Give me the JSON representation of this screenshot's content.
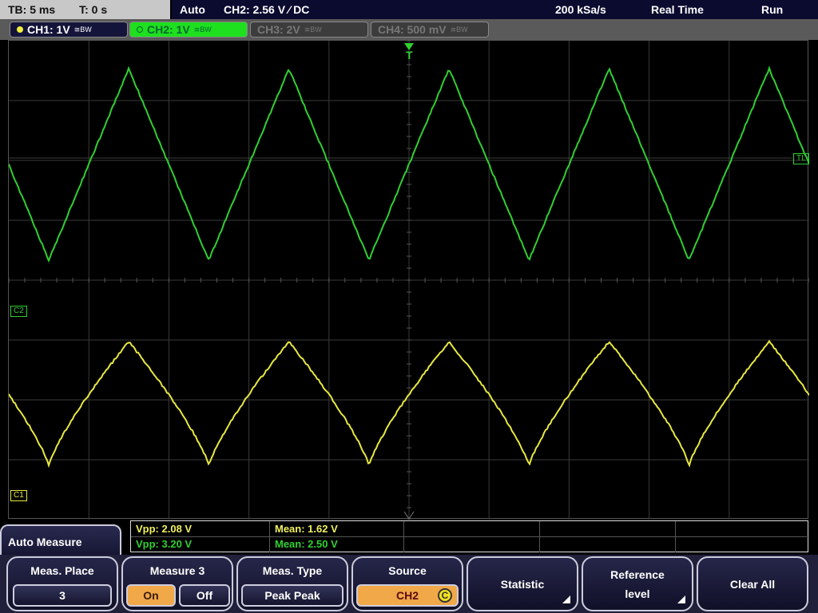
{
  "header": {
    "timebase": "TB: 5 ms",
    "trigger_time": "T: 0 s",
    "mode": "Auto",
    "trigger": "CH2: 2.56 V ⁄ DC",
    "sample_rate": "200 kSa/s",
    "acquisition": "Real Time",
    "run_state": "Run"
  },
  "channels": [
    {
      "label": "CH1: 1V",
      "coupling": "≅BW",
      "state": "active",
      "color": "#f0f040"
    },
    {
      "label": "CH2: 1V",
      "coupling": "≅BW",
      "state": "selected",
      "color": "#20e020"
    },
    {
      "label": "CH3: 2V",
      "coupling": "≅BW",
      "state": "off",
      "color": "#888888"
    },
    {
      "label": "CH4: 500 mV",
      "coupling": "≅BW",
      "state": "off",
      "color": "#888888"
    }
  ],
  "markers": {
    "trigger": "T",
    "trigger_level": "TL",
    "ch2": "C2",
    "ch1": "C1"
  },
  "waveforms": {
    "ch2": {
      "shape": "triangle",
      "period_ms": 10,
      "vpp": 3.2,
      "mean": 2.5,
      "color": "#30d030"
    },
    "ch1": {
      "shape": "triangle",
      "period_ms": 10,
      "vpp": 2.08,
      "mean": 1.62,
      "color": "#e8e840"
    }
  },
  "measurements": {
    "rows": [
      [
        "Vpp: 2.08 V",
        "Mean: 1.62 V",
        "",
        "",
        ""
      ],
      [
        "Vpp: 3.20 V",
        "Mean: 2.50 V",
        "",
        "",
        ""
      ]
    ],
    "row_colors": [
      "#f0f060",
      "#30d030"
    ]
  },
  "menu": {
    "title": "Auto Measure",
    "meas_place": {
      "label": "Meas. Place",
      "value": "3"
    },
    "measure3": {
      "label": "Measure 3",
      "on": "On",
      "off": "Off",
      "selected": "On"
    },
    "meas_type": {
      "label": "Meas. Type",
      "value": "Peak Peak"
    },
    "source": {
      "label": "Source",
      "value": "CH2",
      "icon": "c-circle-icon"
    },
    "statistic": "Statistic",
    "reference_level": [
      "Reference",
      "level"
    ],
    "clear_all": "Clear All"
  }
}
